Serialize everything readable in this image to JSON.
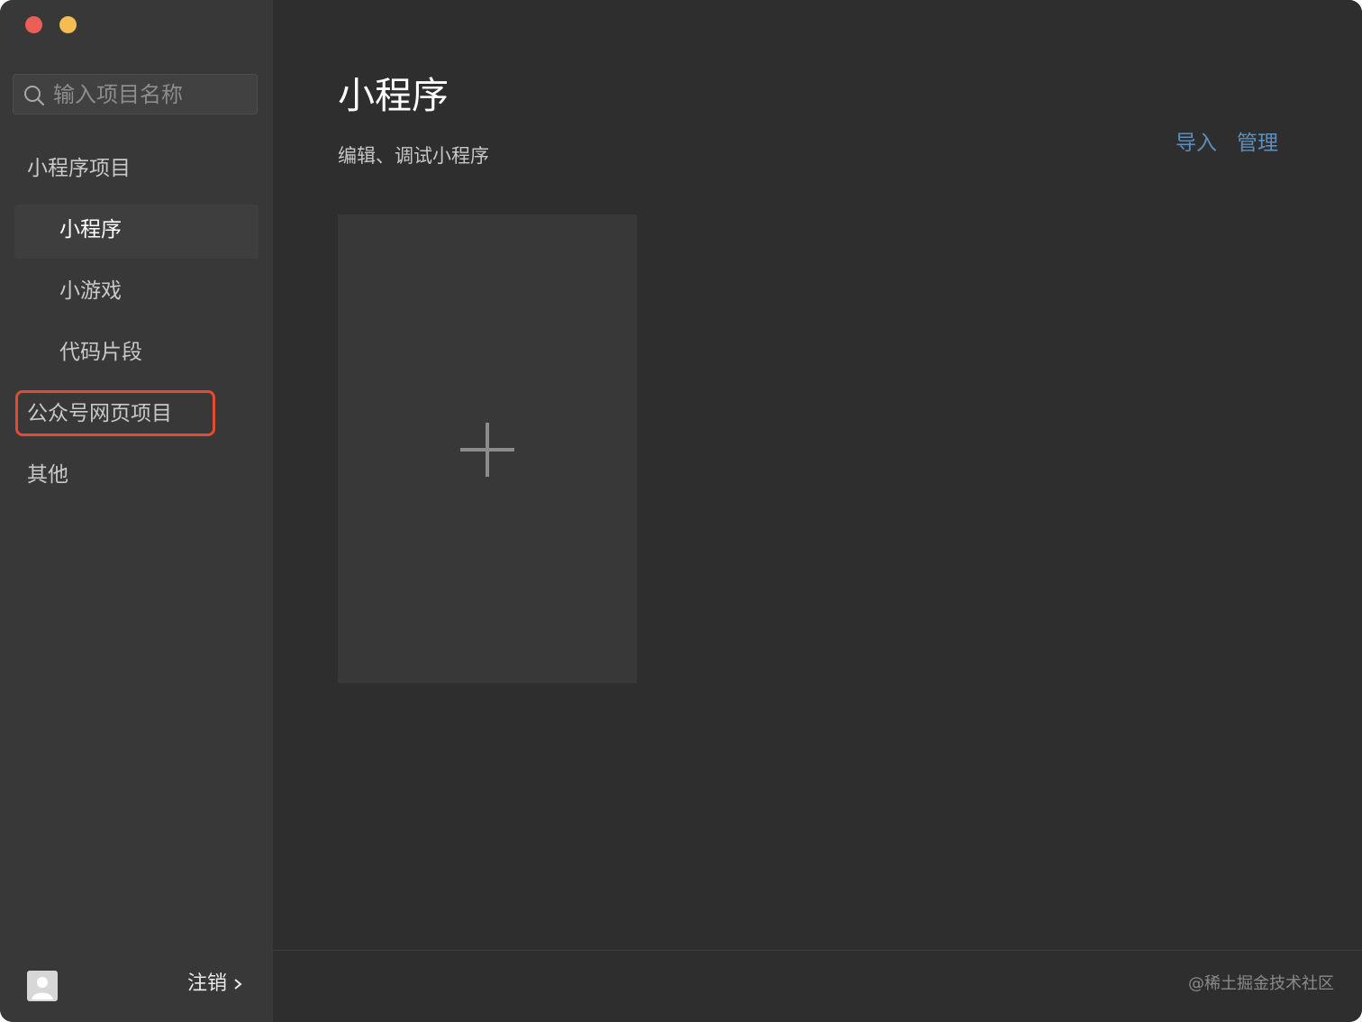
{
  "search": {
    "placeholder": "输入项目名称",
    "value": ""
  },
  "sidebar": {
    "items": [
      {
        "label": "小程序项目",
        "type": "section"
      },
      {
        "label": "小程序",
        "type": "sub",
        "active": true
      },
      {
        "label": "小游戏",
        "type": "sub"
      },
      {
        "label": "代码片段",
        "type": "sub"
      },
      {
        "label": "公众号网页项目",
        "type": "section",
        "highlighted": true
      },
      {
        "label": "其他",
        "type": "section"
      }
    ],
    "logout_label": "注销"
  },
  "main": {
    "title": "小程序",
    "subtitle": "编辑、调试小程序",
    "import_label": "导入",
    "manage_label": "管理"
  },
  "watermark": "@稀土掘金技术社区",
  "colors": {
    "sidebar_bg": "#383838",
    "main_bg": "#2e2e2e",
    "link": "#5c8fbe",
    "highlight": "#e24b34",
    "traffic_close": "#ec5f56",
    "traffic_minimize": "#f3be4f"
  },
  "icons": [
    "search-icon",
    "plus-icon",
    "chevron-right-icon",
    "avatar-icon"
  ]
}
